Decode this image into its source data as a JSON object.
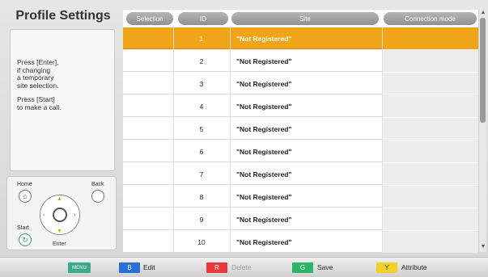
{
  "panel": {
    "title": "Profile Settings",
    "help_enter": "Press [Enter],\nif changing\na temporary\nsite selection.",
    "help_start": "Press [Start]\nto make a call."
  },
  "remote": {
    "home_label": "Home",
    "back_label": "Back",
    "start_label": "Start",
    "enter_label": "Enter"
  },
  "table": {
    "headers": [
      "Selection",
      "ID",
      "Site",
      "Connection mode"
    ],
    "rows": [
      {
        "selection": "",
        "id": "1",
        "site": "\"Not Registered\"",
        "mode": "",
        "selected": true
      },
      {
        "selection": "",
        "id": "2",
        "site": "\"Not Registered\"",
        "mode": ""
      },
      {
        "selection": "",
        "id": "3",
        "site": "\"Not Registered\"",
        "mode": ""
      },
      {
        "selection": "",
        "id": "4",
        "site": "\"Not Registered\"",
        "mode": ""
      },
      {
        "selection": "",
        "id": "5",
        "site": "\"Not Registered\"",
        "mode": ""
      },
      {
        "selection": "",
        "id": "6",
        "site": "\"Not Registered\"",
        "mode": ""
      },
      {
        "selection": "",
        "id": "7",
        "site": "\"Not Registered\"",
        "mode": ""
      },
      {
        "selection": "",
        "id": "8",
        "site": "\"Not Registered\"",
        "mode": ""
      },
      {
        "selection": "",
        "id": "9",
        "site": "\"Not Registered\"",
        "mode": ""
      },
      {
        "selection": "",
        "id": "10",
        "site": "\"Not Registered\"",
        "mode": ""
      }
    ]
  },
  "bottom_bar": {
    "menu_key": "MENU",
    "edit_key": "B",
    "edit_label": "Edit",
    "delete_key": "R",
    "delete_label": "Delete",
    "save_key": "G",
    "save_label": "Save",
    "attribute_key": "Y",
    "attribute_label": "Attribute"
  },
  "colors": {
    "selected_row": "#f0a417",
    "menu_key": "#3aaa8a",
    "blue_key": "#2a6fd6",
    "red_key": "#e83a3a",
    "green_key": "#2fb56a",
    "yellow_key": "#f2d22a"
  }
}
